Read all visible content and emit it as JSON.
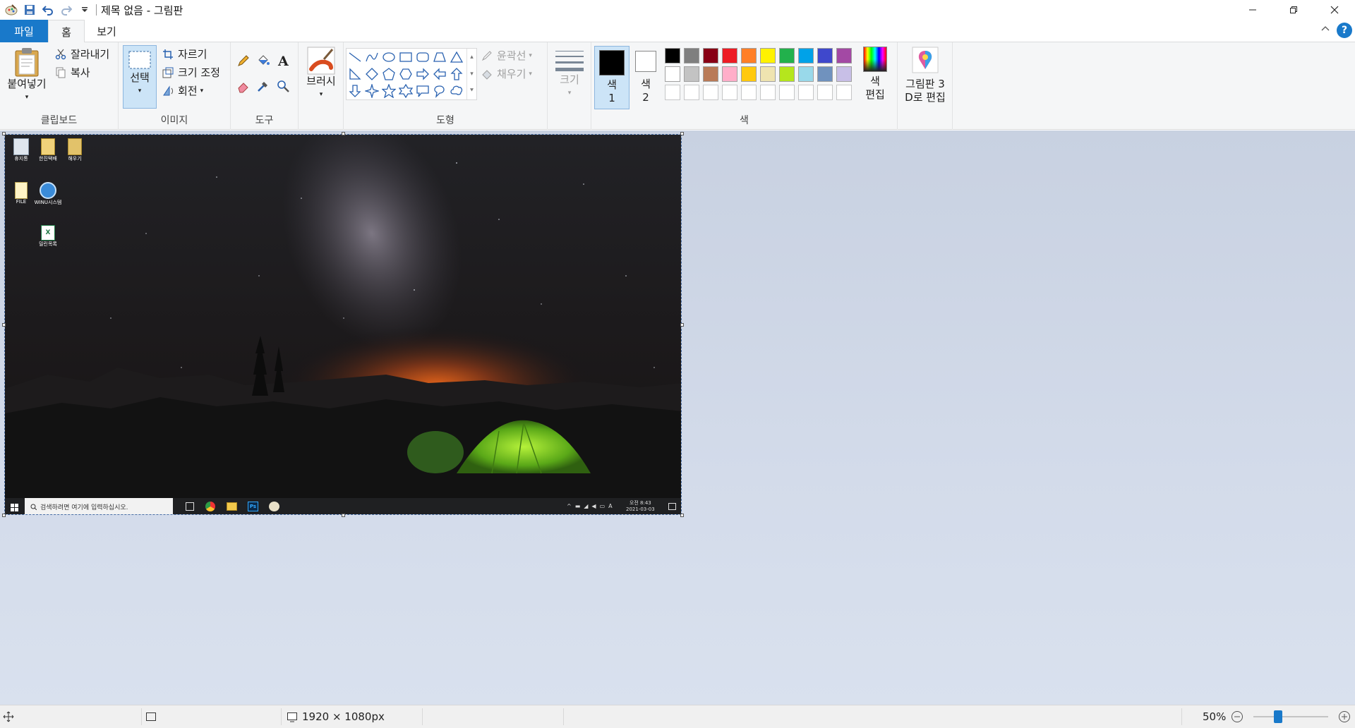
{
  "window": {
    "title": "제목 없음 - 그림판",
    "controls": [
      "minimize-icon",
      "maximize-icon",
      "close-icon"
    ]
  },
  "tabs": {
    "file": "파일",
    "home": "홈",
    "view": "보기"
  },
  "ribbon": {
    "clipboard": {
      "label": "클립보드",
      "paste": "붙여넣기",
      "cut": "잘라내기",
      "copy": "복사"
    },
    "image": {
      "label": "이미지",
      "select": "선택",
      "crop": "자르기",
      "resize": "크기 조정",
      "rotate": "회전"
    },
    "tools": {
      "label": "도구"
    },
    "brushes": {
      "label": "브러시"
    },
    "shapes": {
      "label": "도형",
      "outline": "윤곽선",
      "fill": "채우기"
    },
    "size": {
      "label": "크기"
    },
    "colors": {
      "label": "색",
      "color1_a": "색",
      "color1_b": "1",
      "color2_a": "색",
      "color2_b": "2",
      "edit_a": "색",
      "edit_b": "편집",
      "color1_value": "#000000",
      "color2_value": "#ffffff",
      "palette_row1": [
        "#000000",
        "#7f7f7f",
        "#880015",
        "#ed1c24",
        "#ff7f27",
        "#fff200",
        "#22b14c",
        "#00a2e8",
        "#3f48cc",
        "#a349a4"
      ],
      "palette_row2": [
        "#ffffff",
        "#c3c3c3",
        "#b97a57",
        "#ffaec9",
        "#ffc90e",
        "#efe4b0",
        "#b5e61d",
        "#99d9ea",
        "#7092be",
        "#c8bfe7"
      ]
    },
    "paint3d": {
      "line1": "그림판 3",
      "line2": "D로 편집"
    }
  },
  "desktop_image": {
    "icons": [
      {
        "label": "휴지통"
      },
      {
        "label": "한진택배"
      },
      {
        "label": "해우기"
      },
      {
        "label": "FILE"
      },
      {
        "label": "WINU시스템"
      },
      {
        "label": "밀린목록"
      }
    ],
    "taskbar": {
      "search_placeholder": "검색하려면 여기에 입력하십시오.",
      "ime": "A",
      "time": "오전 8:43",
      "date": "2021-03-03"
    }
  },
  "statusbar": {
    "dimensions": "1920 × 1080px",
    "zoom": "50%",
    "zoom_level": 0.5
  }
}
